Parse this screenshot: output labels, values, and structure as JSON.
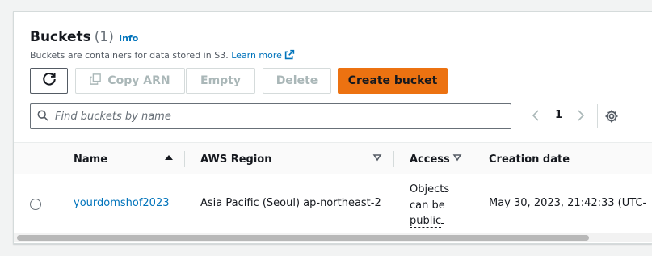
{
  "header": {
    "title": "Buckets",
    "count": "(1)",
    "info_link": "Info",
    "description": "Buckets are containers for data stored in S3.",
    "learn_more": "Learn more"
  },
  "toolbar": {
    "copy_arn_label": "Copy ARN",
    "empty_label": "Empty",
    "delete_label": "Delete",
    "create_label": "Create bucket"
  },
  "search": {
    "placeholder": "Find buckets by name",
    "value": ""
  },
  "pagination": {
    "current_page": "1"
  },
  "table": {
    "columns": [
      {
        "label": "Name"
      },
      {
        "label": "AWS Region"
      },
      {
        "label": "Access"
      },
      {
        "label": "Creation date"
      }
    ],
    "rows": [
      {
        "name": "yourdomshof2023",
        "region": "Asia Pacific (Seoul) ap-northeast-2",
        "access_line1": "Objects",
        "access_line2": "can be",
        "access_line3": "public",
        "creation_date": "May 30, 2023, 21:42:33 (UTC-"
      }
    ]
  },
  "colors": {
    "accent": "#ec7211",
    "link": "#0073bb",
    "disabled_text": "#aab7b8",
    "border": "#d5dbdb"
  },
  "icons": {
    "refresh": "refresh-icon",
    "copy": "copy-icon",
    "external": "external-link-icon",
    "search": "search-icon",
    "prev": "chevron-left-icon",
    "next": "chevron-right-icon",
    "settings": "gear-icon",
    "sort_asc": "sort-ascending-icon",
    "sort_desc": "sort-caret-down-icon"
  }
}
